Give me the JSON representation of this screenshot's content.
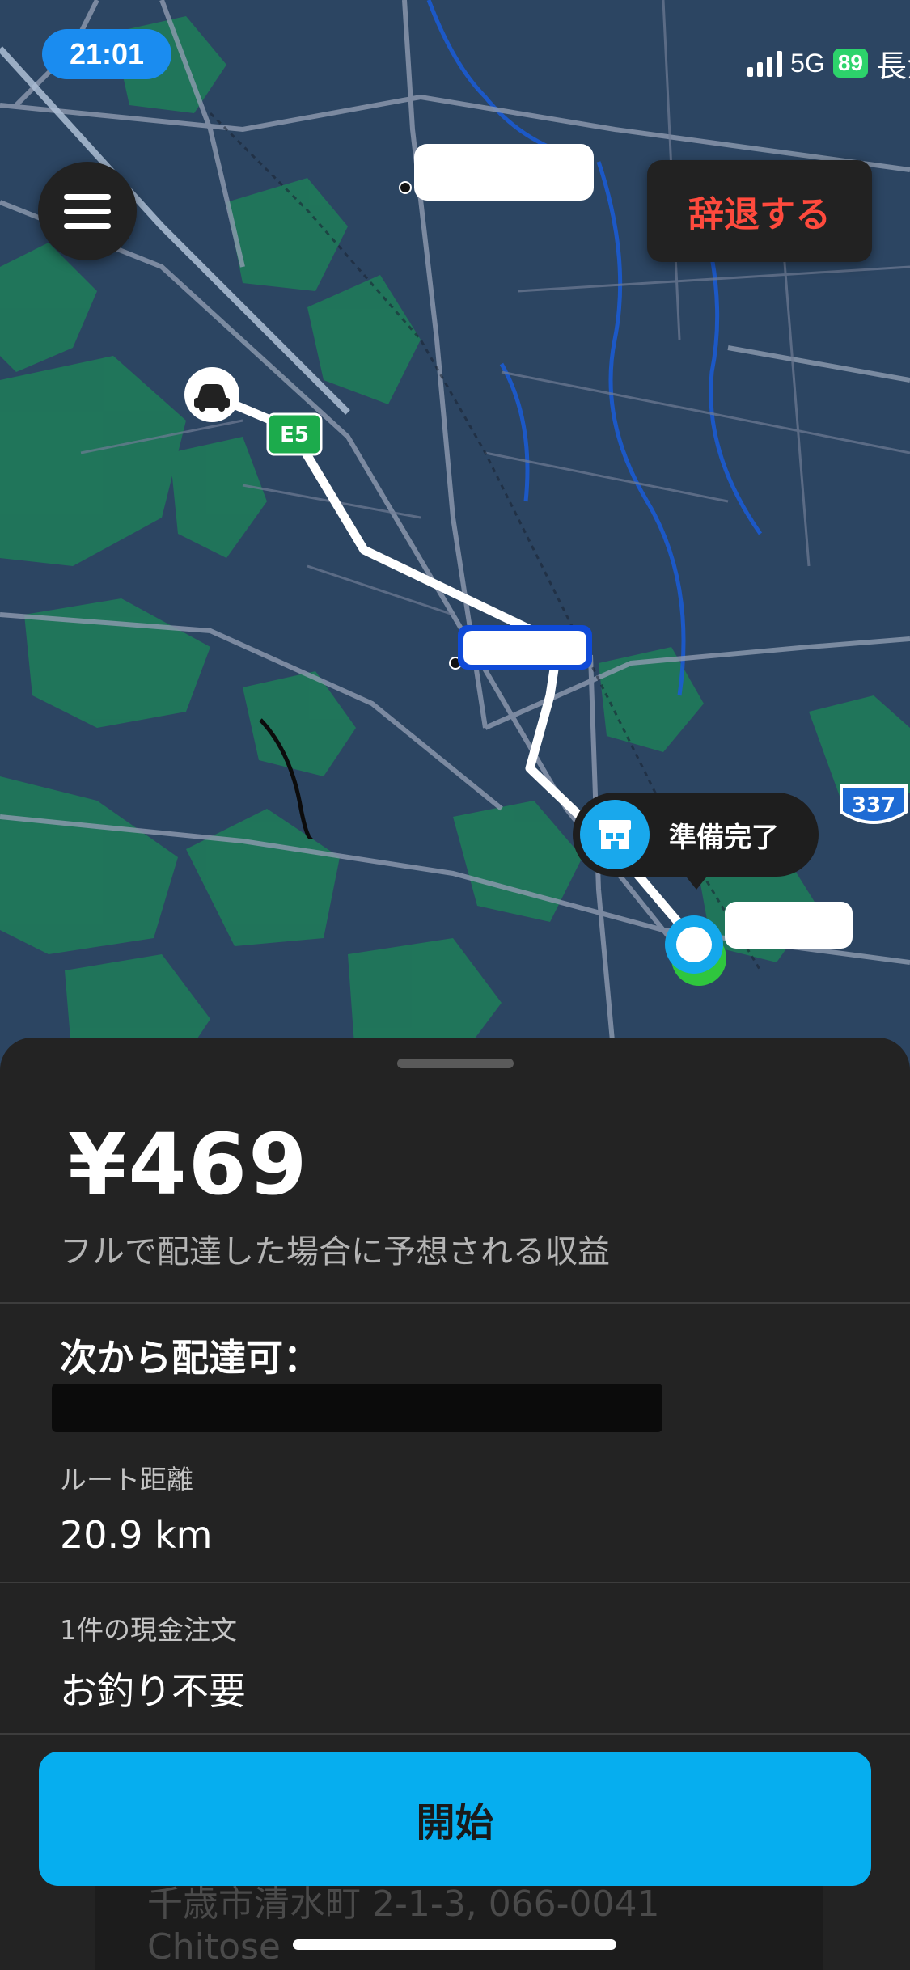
{
  "status_bar": {
    "time": "21:01",
    "network": "5G",
    "battery": "89",
    "carrier": "長沙"
  },
  "map": {
    "highway_label": "E5",
    "route_number": "337",
    "store_status_label": "準備完了"
  },
  "header": {
    "decline_label": "辞退する"
  },
  "sheet": {
    "earnings": "¥469",
    "earnings_description": "フルで配達した場合に予想される収益",
    "available_from_label": "次から配達可：",
    "route_distance_label": "ルート距離",
    "route_distance_value": "20.9 km",
    "cash_order_label": "1件の現金注文",
    "cash_order_value": "お釣り不要",
    "start_label": "開始",
    "address_line1": "千歳市清水町 2-1-3, 066-0041",
    "address_line2": "Chitose"
  },
  "colors": {
    "accent": "#06aeef",
    "decline": "#ff4a3d",
    "map_water": "#2c4562",
    "map_green": "#1f7a5a"
  }
}
